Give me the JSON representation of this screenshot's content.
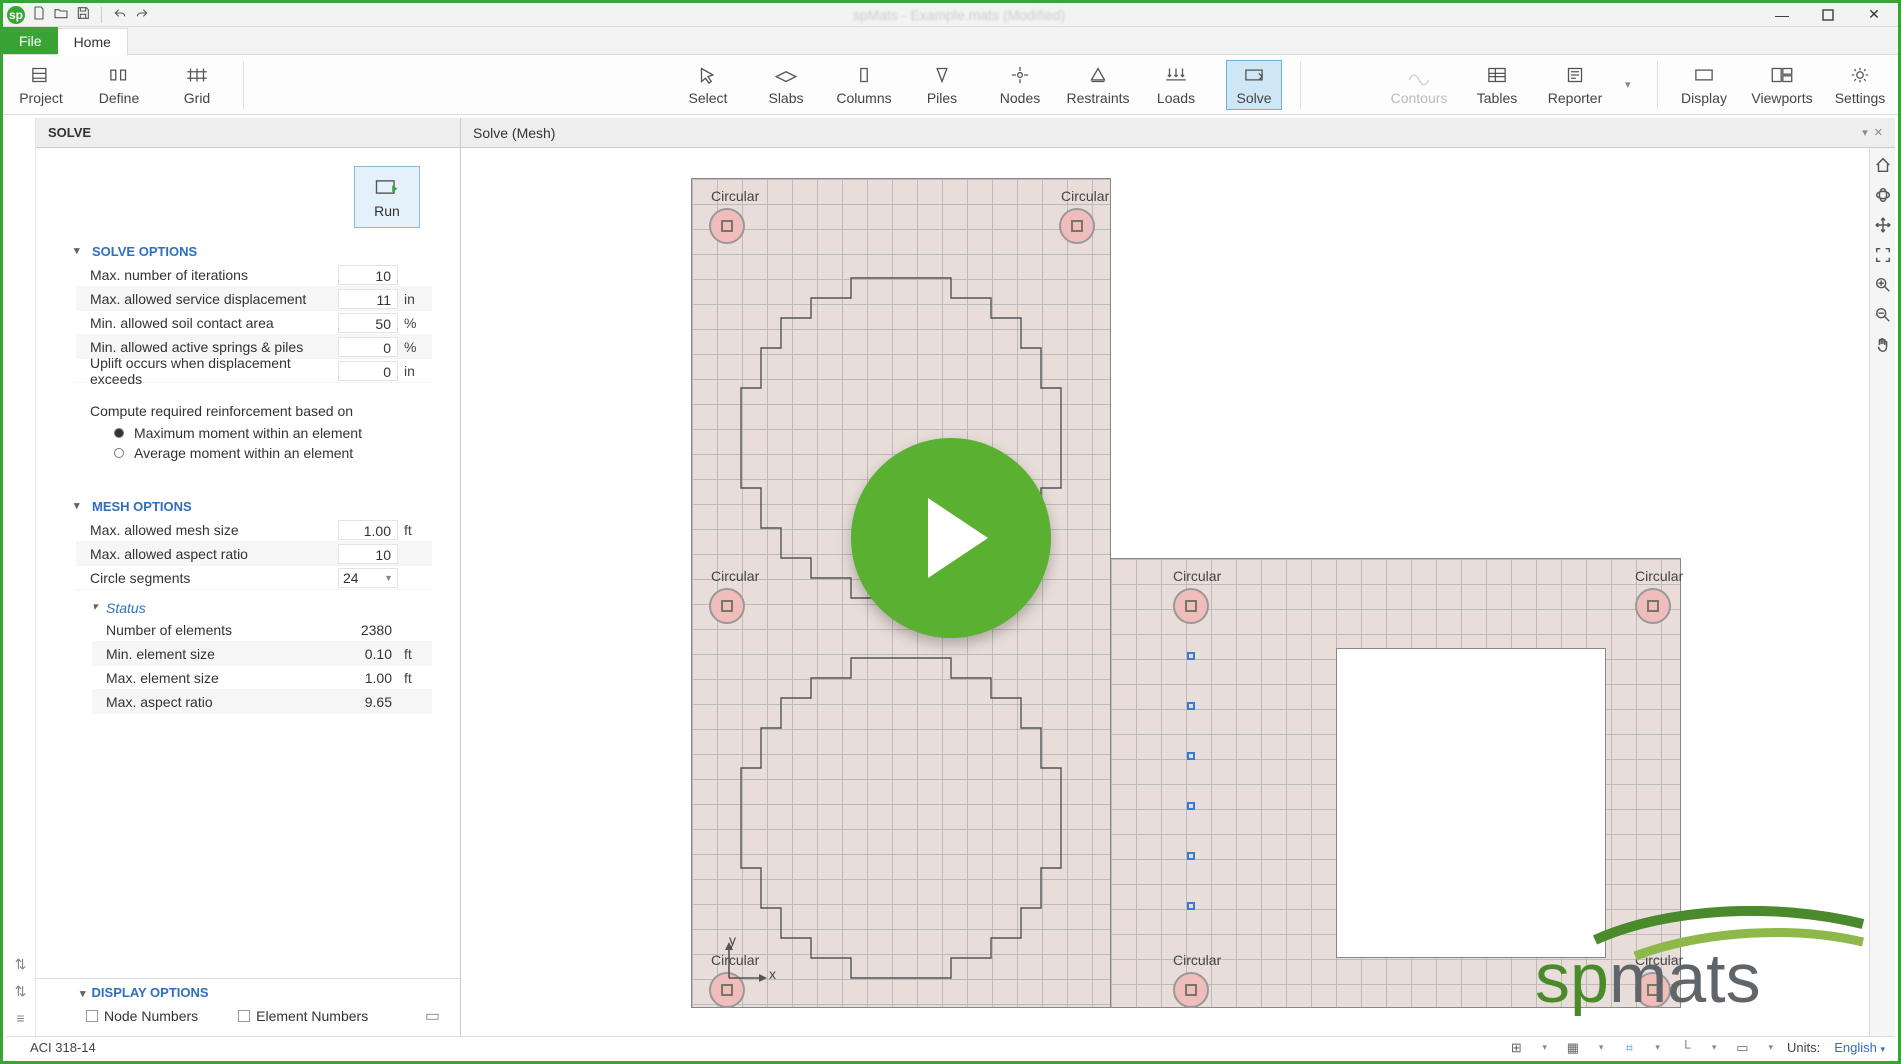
{
  "window": {
    "title": "spMats - Example.mats (Modified)"
  },
  "tabs": {
    "file": "File",
    "home": "Home"
  },
  "ribbon": {
    "project": "Project",
    "define": "Define",
    "grid": "Grid",
    "select": "Select",
    "slabs": "Slabs",
    "columns": "Columns",
    "piles": "Piles",
    "nodes": "Nodes",
    "restraints": "Restraints",
    "loads": "Loads",
    "solve": "Solve",
    "contours": "Contours",
    "tables": "Tables",
    "reporter": "Reporter",
    "display": "Display",
    "viewports": "Viewports",
    "settings": "Settings"
  },
  "panel": {
    "title": "SOLVE",
    "run": "Run",
    "solve_options_title": "SOLVE OPTIONS",
    "mesh_options_title": "MESH OPTIONS",
    "status_title": "Status",
    "compute_note": "Compute required reinforcement based on",
    "radio_max": "Maximum moment within an element",
    "radio_avg": "Average moment within an element",
    "display_options_title": "DISPLAY OPTIONS",
    "node_numbers": "Node Numbers",
    "element_numbers": "Element Numbers",
    "solve": {
      "max_iter_lbl": "Max. number of iterations",
      "max_iter_val": "10",
      "max_iter_unit": "",
      "max_disp_lbl": "Max. allowed service displacement",
      "max_disp_val": "11",
      "max_disp_unit": "in",
      "min_soil_lbl": "Min. allowed soil contact area",
      "min_soil_val": "50",
      "min_soil_unit": "%",
      "min_springs_lbl": "Min. allowed active springs & piles",
      "min_springs_val": "0",
      "min_springs_unit": "%",
      "uplift_lbl": "Uplift occurs when displacement exceeds",
      "uplift_val": "0",
      "uplift_unit": "in"
    },
    "mesh": {
      "max_mesh_lbl": "Max. allowed mesh size",
      "max_mesh_val": "1.00",
      "max_mesh_unit": "ft",
      "max_aspect_lbl": "Max. allowed aspect ratio",
      "max_aspect_val": "10",
      "max_aspect_unit": "",
      "circle_seg_lbl": "Circle segments",
      "circle_seg_val": "24"
    },
    "status": {
      "n_elem_lbl": "Number of elements",
      "n_elem_val": "2380",
      "min_el_lbl": "Min. element size",
      "min_el_val": "0.10",
      "min_el_unit": "ft",
      "max_el_lbl": "Max. element size",
      "max_el_val": "1.00",
      "max_el_unit": "ft",
      "max_ar_lbl": "Max. aspect ratio",
      "max_ar_val": "9.65"
    }
  },
  "canvas": {
    "header": "Solve (Mesh)",
    "col_label": "Circular",
    "axes": {
      "x": "x",
      "y": "y"
    }
  },
  "statusbar": {
    "code": "ACI 318-14",
    "units_label": "Units:",
    "units_value": "English"
  },
  "logo": {
    "prefix": "sp",
    "word": "mats"
  }
}
